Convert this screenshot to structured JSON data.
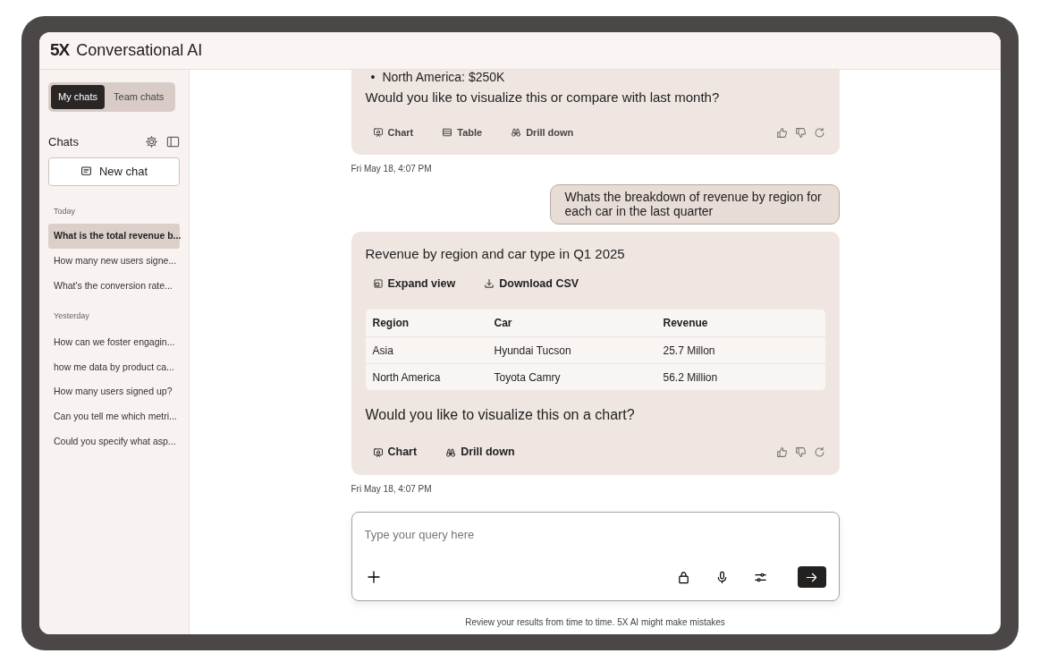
{
  "app": {
    "logo": "5X",
    "title": "Conversational AI"
  },
  "sidebar": {
    "tabs": [
      {
        "label": "My chats",
        "selected": true
      },
      {
        "label": "Team chats",
        "selected": false
      }
    ],
    "heading": "Chats",
    "new_chat": "New chat",
    "groups": [
      {
        "label": "Today",
        "items": [
          {
            "title": "What is the total revenue b...",
            "selected": true
          },
          {
            "title": "How many new users signe...",
            "selected": false
          },
          {
            "title": "What's the conversion rate...",
            "selected": false
          }
        ]
      },
      {
        "label": "Yesterday",
        "items": [
          {
            "title": "How can we foster engagin...",
            "selected": false
          },
          {
            "title": "how me data by product ca...",
            "selected": false
          },
          {
            "title": "How many users signed up?",
            "selected": false
          },
          {
            "title": "Can you tell me which metri...",
            "selected": false
          },
          {
            "title": "Could you specify what asp...",
            "selected": false
          }
        ]
      }
    ]
  },
  "messages": [
    {
      "kind": "assistant",
      "bullet_marker": "•",
      "bullets": [
        "North America: $250K"
      ],
      "text": "Would you like to visualize this or compare with last month?",
      "actions": [
        {
          "label": "Chart",
          "kind": "chart"
        },
        {
          "label": "Table",
          "kind": "table"
        },
        {
          "label": "Drill down",
          "kind": "drill"
        }
      ]
    },
    {
      "kind": "timestamp",
      "text": "Fri May 18, 4:07 PM"
    },
    {
      "kind": "user",
      "text": "Whats the breakdown of revenue by region for each car in the last quarter"
    },
    {
      "kind": "assistant",
      "title": "Revenue by region and car type in Q1 2025",
      "tools": [
        {
          "label": "Expand view",
          "kind": "expand"
        },
        {
          "label": "Download CSV",
          "kind": "download"
        }
      ],
      "table": {
        "columns": [
          "Region",
          "Car",
          "Revenue"
        ],
        "rows": [
          [
            "Asia",
            "Hyundai Tucson",
            "25.7 Millon"
          ],
          [
            "North America",
            "Toyota Camry",
            "56.2 Million"
          ]
        ]
      },
      "text": "Would you like to visualize this on a chart?",
      "actions": [
        {
          "label": "Chart",
          "kind": "chart"
        },
        {
          "label": "Drill down",
          "kind": "drill"
        }
      ]
    },
    {
      "kind": "timestamp",
      "text": "Fri May 18, 4:07 PM"
    }
  ],
  "composer": {
    "placeholder": "Type your query here"
  },
  "disclaimer": "Review your results from time to time. 5X AI might make mistakes"
}
